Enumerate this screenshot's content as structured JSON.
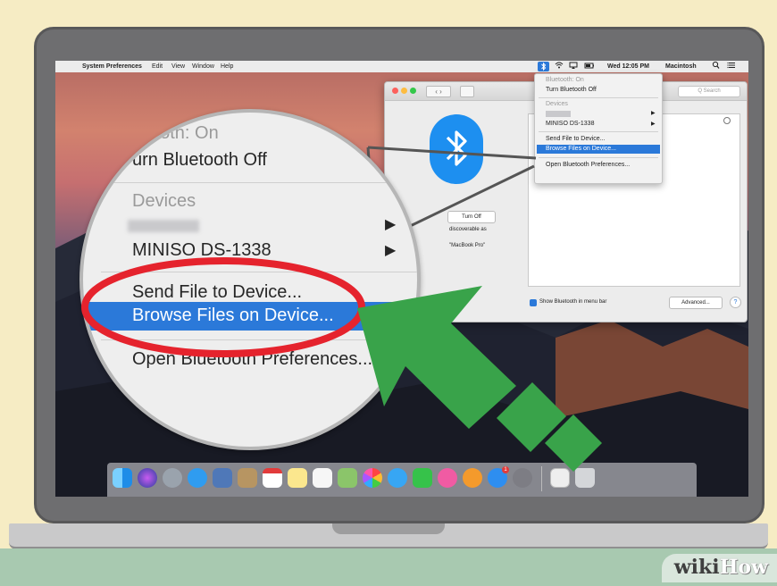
{
  "menubar": {
    "apple": "",
    "app_name": "System Preferences",
    "items": [
      "Edit",
      "View",
      "Window",
      "Help"
    ],
    "clock": "Wed 12:05 PM",
    "user": "Macintosh"
  },
  "prefs_window": {
    "search_placeholder": "Q Search",
    "turn_off_button": "Turn Off",
    "discoverable_text": "discoverable as",
    "device_name": "\"MacBook Pro\"",
    "show_in_menu_checkbox": "Show Bluetooth in menu bar",
    "advanced_button": "Advanced...",
    "help_button": "?"
  },
  "bluetooth_menu_small": {
    "status": "Bluetooth: On",
    "turn_off": "Turn Bluetooth Off",
    "devices_header": "Devices",
    "device_2": "MINISO DS-1338",
    "send_file": "Send File to Device...",
    "browse_files": "Browse Files on Device...",
    "open_prefs": "Open Bluetooth Preferences..."
  },
  "zoom": {
    "status": "ooth: On",
    "turn_off": "urn Bluetooth Off",
    "devices_header": "Devices",
    "device_2": "MINISO DS-1338",
    "send_file": "Send File to Device...",
    "browse_files": "Browse Files on Device...",
    "open_prefs": "Open Bluetooth Preferences..."
  },
  "dock": {
    "app_store_badge": "1"
  },
  "watermark": {
    "part1": "wiki",
    "part2": "How"
  },
  "colors": {
    "highlight_blue": "#2b79d9",
    "annotation_red": "#e5232d",
    "arrow_green": "#39a34a",
    "bluetooth_blue": "#1d8ff0"
  }
}
